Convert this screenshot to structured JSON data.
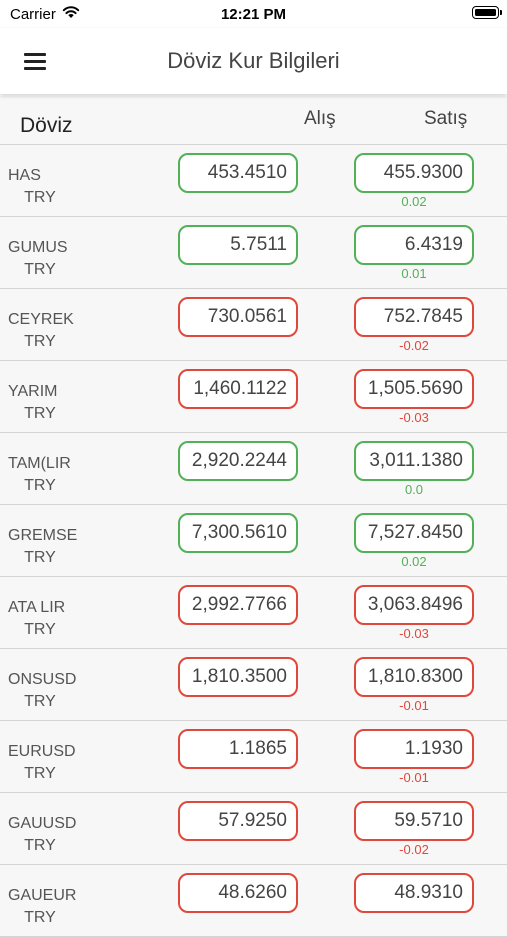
{
  "status_bar": {
    "carrier": "Carrier",
    "time": "12:21 PM"
  },
  "nav": {
    "title": "Döviz Kur Bilgileri",
    "menu_icon": "hamburger-menu-icon"
  },
  "table": {
    "col_currency": "Döviz",
    "col_buy": "Alış",
    "col_sell": "Satış"
  },
  "colors": {
    "up": "#52b058",
    "down": "#e0483c"
  },
  "rows": [
    {
      "name": "HAS",
      "sub": "TRY",
      "buy": "453.4510",
      "sell": "455.9300",
      "change": "0.02",
      "trend": "up"
    },
    {
      "name": "GUMUS",
      "sub": "TRY",
      "buy": "5.7511",
      "sell": "6.4319",
      "change": "0.01",
      "trend": "up"
    },
    {
      "name": "CEYREK",
      "sub": "TRY",
      "buy": "730.0561",
      "sell": "752.7845",
      "change": "-0.02",
      "trend": "down"
    },
    {
      "name": "YARIM",
      "sub": "TRY",
      "buy": "1,460.1122",
      "sell": "1,505.5690",
      "change": "-0.03",
      "trend": "down"
    },
    {
      "name": "TAM(LIR",
      "sub": "TRY",
      "buy": "2,920.2244",
      "sell": "3,011.1380",
      "change": "0.0",
      "trend": "up"
    },
    {
      "name": "GREMSE",
      "sub": "TRY",
      "buy": "7,300.5610",
      "sell": "7,527.8450",
      "change": "0.02",
      "trend": "up"
    },
    {
      "name": "ATA LIR",
      "sub": "TRY",
      "buy": "2,992.7766",
      "sell": "3,063.8496",
      "change": "-0.03",
      "trend": "down"
    },
    {
      "name": "ONSUSD",
      "sub": "TRY",
      "buy": "1,810.3500",
      "sell": "1,810.8300",
      "change": "-0.01",
      "trend": "down"
    },
    {
      "name": "EURUSD",
      "sub": "TRY",
      "buy": "1.1865",
      "sell": "1.1930",
      "change": "-0.01",
      "trend": "down"
    },
    {
      "name": "GAUUSD",
      "sub": "TRY",
      "buy": "57.9250",
      "sell": "59.5710",
      "change": "-0.02",
      "trend": "down"
    },
    {
      "name": "GAUEUR",
      "sub": "TRY",
      "buy": "48.6260",
      "sell": "48.9310",
      "change": "",
      "trend": "down"
    }
  ]
}
